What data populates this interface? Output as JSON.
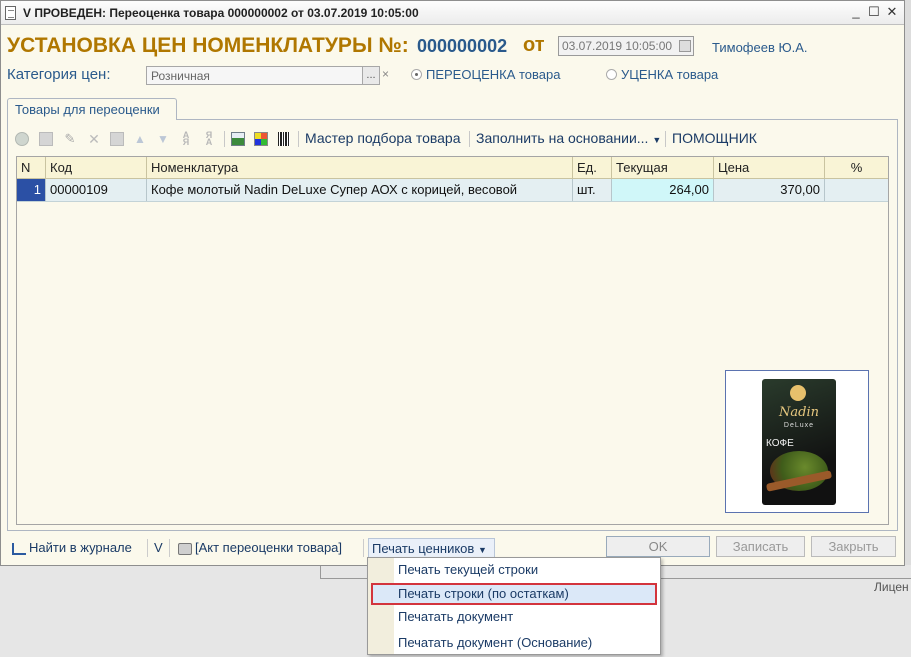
{
  "window": {
    "title": "V ПРОВЕДЕН: Переоценка товара 000000002 от 03.07.2019 10:05:00",
    "controls": [
      "_",
      "☐",
      "✕"
    ]
  },
  "header": {
    "heading": "УСТАНОВКА ЦЕН НОМЕНКЛАТУРЫ №:",
    "doc_number": "000000002",
    "from_label": "от",
    "date": "03.07.2019 10:05:00",
    "author": "Тимофеев Ю.А."
  },
  "category": {
    "label": "Категория цен:",
    "value": "Розничная",
    "select_label": "...",
    "clear_label": "×"
  },
  "mode": {
    "option1": "ПЕРЕОЦЕНКА товара",
    "option2": "УЦЕНКА товара",
    "selected": "ПЕРЕОЦЕНКА товара"
  },
  "tab": {
    "label": "Товары для переоценки"
  },
  "toolbar": {
    "wizard": "Мастер подбора товара",
    "fill_by": "Заполнить на основании...",
    "assistant": "ПОМОЩНИК",
    "icons": [
      "add-icon",
      "copy-icon",
      "edit-icon",
      "delete-icon",
      "save-icon",
      "move-up-icon",
      "move-down-icon",
      "sort-asc-icon",
      "sort-desc-icon",
      "calculator-icon",
      "color-palette-icon",
      "barcode-icon"
    ]
  },
  "table": {
    "columns": [
      "N",
      "Код",
      "Номенклатура",
      "Ед.",
      "Текущая",
      "Цена",
      "%"
    ],
    "rows": [
      {
        "n": "1",
        "code": "00000109",
        "name": "Кофе молотый Nadin DeLuxe Супер АОХ с корицей, весовой",
        "unit": "шт.",
        "current": "264,00",
        "price": "370,00",
        "percent": ""
      }
    ]
  },
  "product_image": {
    "logo": "Nadin",
    "sub": "DeLuxe",
    "name": "КОФЕ"
  },
  "bottom": {
    "find_journal": "Найти в журнале",
    "v": "V",
    "act": "[Акт переоценки товара]",
    "print_tags": "Печать ценников",
    "ok": "OK",
    "save": "Записать",
    "close": "Закрыть"
  },
  "menu": {
    "items": [
      "Печать текущей строки",
      "Печать строки (по остаткам)",
      "Печатать документ",
      "Печатать документ (Основание)"
    ],
    "highlighted_index": 1
  },
  "background": {
    "license_text": "Лицен"
  },
  "colors": {
    "heading": "#b07700",
    "link": "#1b3b66",
    "selected_row": "#e4eff2",
    "row_number": "#2b50a5",
    "highlight_border": "#d3343d"
  }
}
